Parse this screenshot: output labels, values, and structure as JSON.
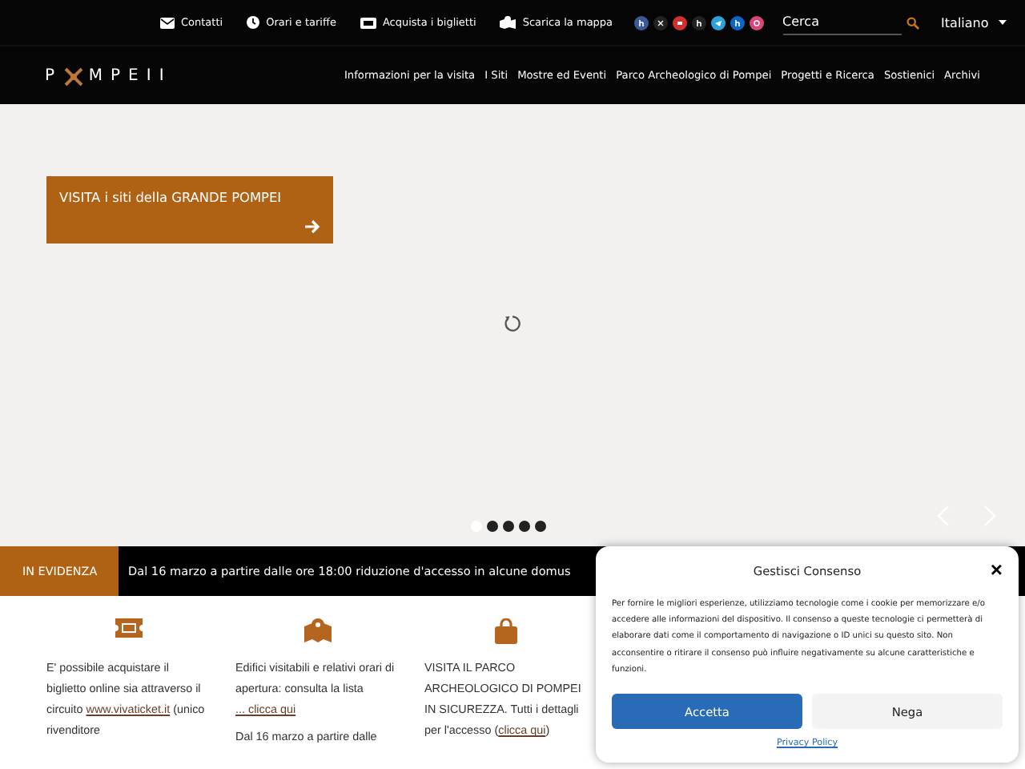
{
  "top_links": [
    {
      "kind": "mail",
      "label": "Contatti"
    },
    {
      "kind": "clock",
      "label": "Orari e tariffe"
    },
    {
      "kind": "ticket",
      "label": "Acquista i biglietti"
    },
    {
      "kind": "map",
      "label": "Scarica la mappa"
    }
  ],
  "social": [
    {
      "kind": "f",
      "color": "#3b5998"
    },
    {
      "kind": "x",
      "color": "#222222"
    },
    {
      "kind": "yt",
      "color": "#d32f2f"
    },
    {
      "kind": "tt",
      "color": "#222222"
    },
    {
      "kind": "tg",
      "color": "#2aa3dd"
    },
    {
      "kind": "in",
      "color": "#0a66c2"
    },
    {
      "kind": "ig",
      "color": "#d9467a"
    }
  ],
  "search": {
    "placeholder": "Cerca"
  },
  "language": "Italiano",
  "logo": "P  MPEII",
  "nav": [
    "Informazioni per la visita",
    "I Siti",
    "Mostre ed Eventi",
    "Parco Archeologico di Pompei",
    "Progetti e Ricerca",
    "Sostienici",
    "Archivi"
  ],
  "hero": {
    "cta": "VISITA i siti della GRANDE POMPEI",
    "dots": [
      {
        "selected": true
      },
      {
        "selected": false
      },
      {
        "selected": false
      },
      {
        "selected": false
      },
      {
        "selected": false
      }
    ]
  },
  "ticker": {
    "label": "IN EVIDENZA",
    "items": [
      "Dal 16 marzo a partire dalle ore 18:00 riduzione d'accesso in alcune domus"
    ]
  },
  "columns": [
    {
      "paragraphs": [
        [
          {
            "text": "E' possibile acquistare il biglietto online sia attraverso il circuito "
          },
          {
            "text": "www.vivaticket.it",
            "link": true
          },
          {
            "text": " (unico rivenditore"
          }
        ]
      ]
    },
    {
      "paragraphs": [
        [
          {
            "text": "Edifici visitabili e relativi orari di apertura: consulta la lista "
          },
          {
            "text": "... clicca qui",
            "link": true
          }
        ],
        [
          {
            "text": "Dal 16 marzo a partire dalle"
          }
        ]
      ]
    },
    {
      "paragraphs": [
        [
          {
            "text": "VISITA IL PARCO ARCHEOLOGICO DI POMPEI IN SICUREZZA. Tutti i dettagli per l'accesso ("
          },
          {
            "text": "clicca qui",
            "link": true
          },
          {
            "text": ")"
          }
        ]
      ]
    }
  ],
  "consent": {
    "title": "Gestisci Consenso",
    "close": "×",
    "body": "Per fornire le migliori esperienze, utilizziamo tecnologie come i cookie per memorizzare e/o accedere alle informazioni del dispositivo. Il consenso a queste tecnologie ci permetterà di elaborare dati come il comportamento di navigazione o ID unici su questo sito. Non acconsentire o ritirare il consenso può influire negativamente su alcune caratteristiche e funzioni.",
    "accept": "Accetta",
    "deny": "Nega",
    "policy": "Privacy Policy"
  }
}
